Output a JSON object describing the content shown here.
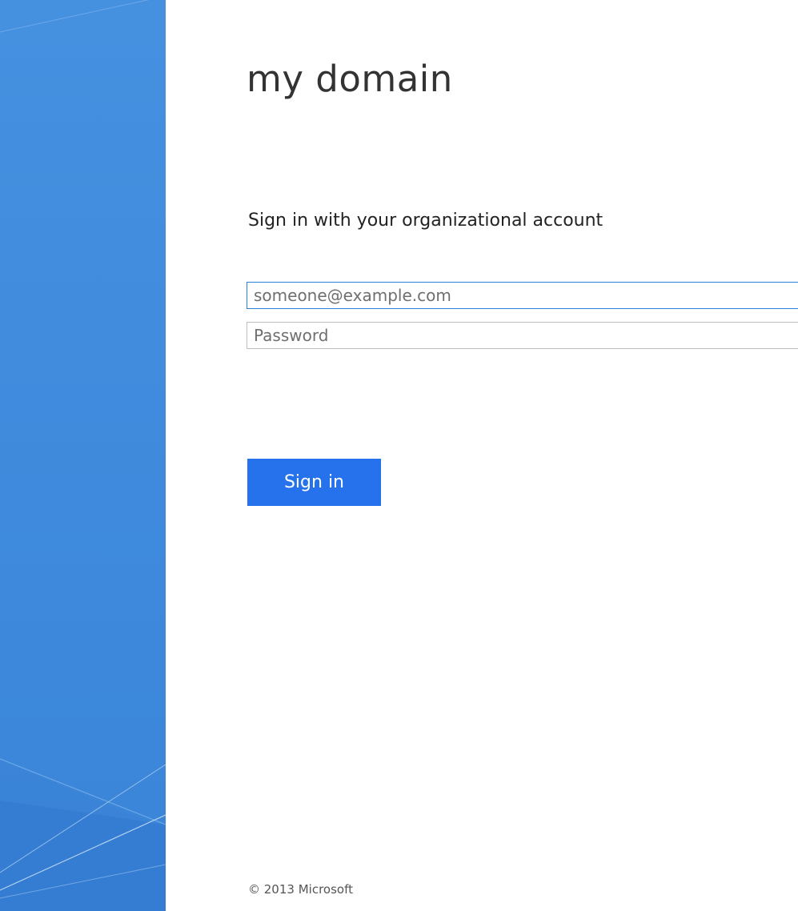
{
  "header": {
    "title": "my domain"
  },
  "form": {
    "heading": "Sign in with your organizational account",
    "email": {
      "value": "",
      "placeholder": "someone@example.com"
    },
    "password": {
      "value": "",
      "placeholder": "Password"
    },
    "submit_label": "Sign in"
  },
  "footer": {
    "copyright": "© 2013 Microsoft"
  },
  "colors": {
    "side_panel": "#4690e0",
    "accent": "#2672ec",
    "focus_border": "#2a7fd8"
  }
}
